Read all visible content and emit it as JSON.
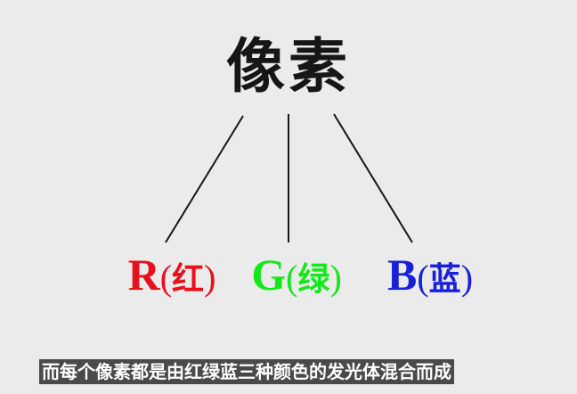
{
  "diagram": {
    "title": "像素",
    "channels": [
      {
        "letter": "R",
        "open": "(",
        "name": "红",
        "close": ")",
        "color": "#e8101a"
      },
      {
        "letter": "G",
        "open": "(",
        "name": "绿",
        "close": ")",
        "color": "#14e81a"
      },
      {
        "letter": "B",
        "open": "(",
        "name": "蓝",
        "close": ")",
        "color": "#1820d8"
      }
    ]
  },
  "caption": {
    "text": "而每个像素都是由红绿蓝三种颜色的发光体混合而成"
  },
  "colors": {
    "background": "#ebebeb",
    "title": "#161616",
    "lines": "#161616",
    "caption_bg": "#4a4a4a",
    "caption_text": "#ffffff"
  }
}
